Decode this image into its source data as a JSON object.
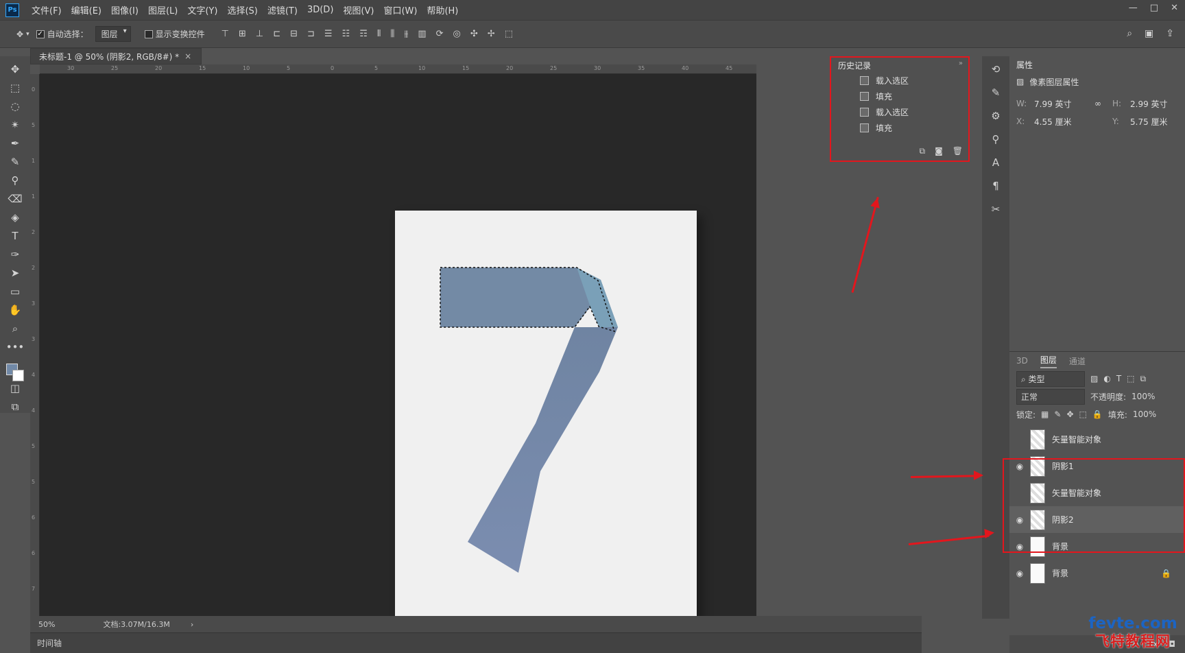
{
  "app": {
    "logo_text": "Ps",
    "menu": [
      "文件(F)",
      "编辑(E)",
      "图像(I)",
      "图层(L)",
      "文字(Y)",
      "选择(S)",
      "滤镜(T)",
      "3D(D)",
      "视图(V)",
      "窗口(W)",
      "帮助(H)"
    ],
    "window_controls": [
      "—",
      "□",
      "✕"
    ]
  },
  "options_bar": {
    "auto_select_label": "自动选择：",
    "auto_select_target": "图层",
    "show_transform_label": "显示变换控件"
  },
  "document_tab": {
    "title": "未标题-1 @ 50% (阴影2, RGB/8#) *",
    "close": "×"
  },
  "ruler": {
    "top_ticks": [
      "30",
      "25",
      "20",
      "15",
      "10",
      "5",
      "0",
      "5",
      "10",
      "15",
      "20",
      "25",
      "30",
      "35",
      "40",
      "45"
    ],
    "left_ticks": [
      "0",
      "5",
      "1",
      "1",
      "2",
      "2",
      "3",
      "3",
      "4",
      "4",
      "5",
      "5",
      "6",
      "6",
      "7"
    ]
  },
  "canvas": {
    "artboard_color": "#f0f0f0",
    "glyph": "7",
    "glyph_color": "#7286a4"
  },
  "status": {
    "zoom": "50%",
    "doc_size": "文档:3.07M/16.3M",
    "chevron": "›",
    "timeline_label": "时间轴"
  },
  "history": {
    "title": "历史记录",
    "items": [
      "载入选区",
      "填充",
      "载入选区",
      "填充"
    ]
  },
  "properties": {
    "title": "属性",
    "subtitle": "像素图层属性",
    "w_label": "W:",
    "w_value": "7.99 英寸",
    "h_label": "H:",
    "h_value": "2.99 英寸",
    "x_label": "X:",
    "x_value": "4.55 厘米",
    "y_label": "Y:",
    "y_value": "5.75 厘米",
    "link_icon": "∞"
  },
  "layers": {
    "tabs": [
      "3D",
      "图层",
      "通道"
    ],
    "active_tab": "图层",
    "filter_label": "类型",
    "blend_mode": "正常",
    "opacity_label": "不透明度:",
    "opacity_value": "100%",
    "lock_label": "锁定:",
    "fill_label": "填充:",
    "fill_value": "100%",
    "items": [
      {
        "name": "矢量智能对象",
        "visible": false,
        "thumb": "smart"
      },
      {
        "name": "阴影1",
        "visible": true,
        "thumb": "checker"
      },
      {
        "name": "矢量智能对象",
        "visible": false,
        "thumb": "smart"
      },
      {
        "name": "阴影2",
        "visible": true,
        "thumb": "checker"
      },
      {
        "name": "背景",
        "visible": true,
        "thumb": "white"
      },
      {
        "name": "背景",
        "visible": true,
        "thumb": "white"
      }
    ],
    "footer_fx": "fx"
  },
  "watermark": {
    "top": "fevte.com",
    "bottom": "飞特教程网"
  },
  "colors": {
    "accent_red": "#e3161d",
    "foreground_swatch": "#7189a7",
    "background_swatch": "#ffffff"
  }
}
